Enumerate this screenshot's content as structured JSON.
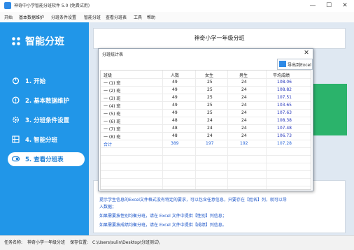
{
  "window": {
    "title": "神奇中小学智能分班软件 5.0 (免费试用)",
    "minimize": "—",
    "maximize": "☐",
    "close": "✕"
  },
  "menubar": [
    "开始",
    "基本数据维护",
    "分班条件设置",
    "智能分班",
    "查看分班表",
    "工具",
    "帮助"
  ],
  "sidebar": {
    "logo_text": "智能分班",
    "items": [
      {
        "label": "1. 开始",
        "icon": "power-icon"
      },
      {
        "label": "2. 基本数据维护",
        "icon": "info-icon"
      },
      {
        "label": "3. 分班条件设置",
        "icon": "gear-icon"
      },
      {
        "label": "4. 智能分班",
        "icon": "grid-icon"
      },
      {
        "label": "5. 查看分班表",
        "icon": "toggle-icon"
      }
    ],
    "active_index": 4
  },
  "main": {
    "school_title": "神奇小学一年级分班",
    "info_lines": [
      "提示学生信息的Excel文件格式没有特定的要求，可以包含任意信息，只要存在【姓名】列，就可以导",
      "入数据；",
      "如果需要按性别均衡分班，请在 Excel 文件中提供【性别】列信息；",
      "如果需要按成绩均衡分班，请在 Excel 文件中提供【成绩】列信息。"
    ]
  },
  "dialog": {
    "title": "分班统计表",
    "close": "✕",
    "export_label": "导出到Excel",
    "columns": [
      "班级",
      "人数",
      "女生",
      "男生",
      "平均成绩"
    ],
    "rows": [
      [
        "一 (1) 班",
        "49",
        "25",
        "24",
        "108.06"
      ],
      [
        "一 (2) 班",
        "49",
        "25",
        "24",
        "108.82"
      ],
      [
        "一 (3) 班",
        "49",
        "25",
        "24",
        "107.51"
      ],
      [
        "一 (4) 班",
        "49",
        "25",
        "24",
        "103.65"
      ],
      [
        "一 (5) 班",
        "49",
        "25",
        "24",
        "107.63"
      ],
      [
        "一 (6) 班",
        "48",
        "24",
        "24",
        "108.38"
      ],
      [
        "一 (7) 班",
        "48",
        "24",
        "24",
        "107.48"
      ],
      [
        "一 (8) 班",
        "48",
        "24",
        "24",
        "106.73"
      ]
    ],
    "total": [
      "合计",
      "389",
      "197",
      "192",
      "107.28"
    ]
  },
  "status": {
    "task_label": "任务名称:",
    "task_value": "神奇小学一年级分班",
    "path_label": "保存位置:",
    "path_value": "C:\\Users\\sulin\\Desktop\\分班测试\\"
  },
  "colors": {
    "sidebar": "#2196e8",
    "accent_green": "#2bb36b",
    "link_blue": "#1c55c8"
  }
}
